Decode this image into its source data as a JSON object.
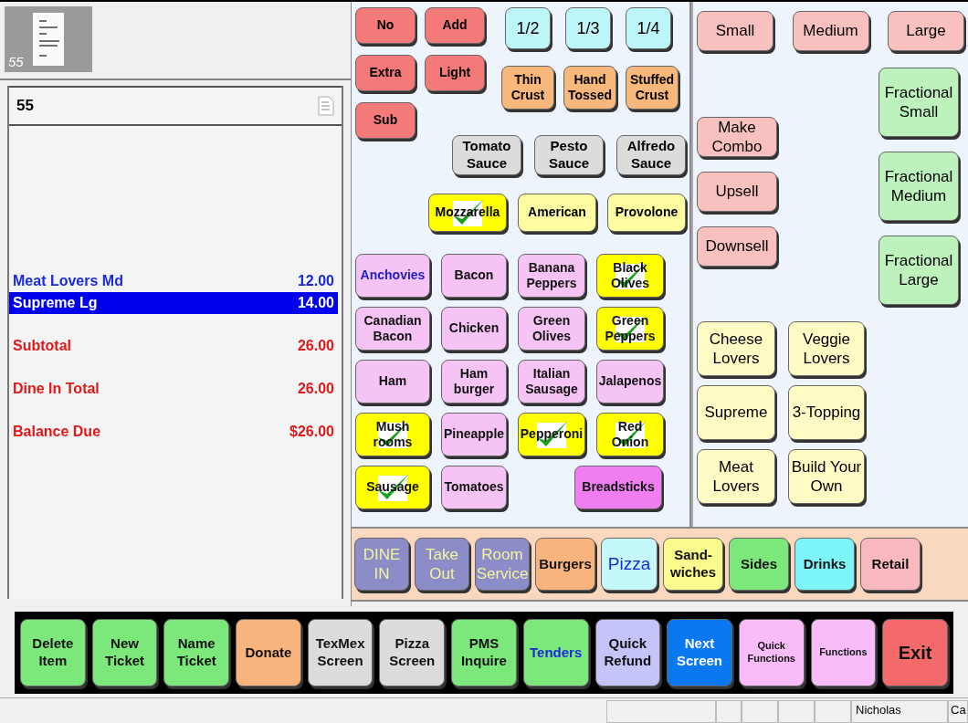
{
  "ticket_tab": {
    "number": "55"
  },
  "receipt": {
    "header": "55",
    "lines": [
      {
        "kind": "item",
        "name": "Meat Lovers Md",
        "amount": "12.00",
        "selected": false
      },
      {
        "kind": "item",
        "name": "Supreme Lg",
        "amount": "14.00",
        "selected": true
      },
      {
        "kind": "total",
        "name": "Subtotal",
        "amount": "26.00",
        "selected": false
      },
      {
        "kind": "total",
        "name": "Dine In Total",
        "amount": "26.00",
        "selected": false
      },
      {
        "kind": "total",
        "name": "Balance Due",
        "amount": "$26.00",
        "selected": false
      }
    ]
  },
  "modifiers": [
    "No",
    "Add",
    "Extra",
    "Light",
    "Sub"
  ],
  "portions": [
    "1/2",
    "1/3",
    "1/4"
  ],
  "crusts": [
    "Thin Crust",
    "Hand Tossed",
    "Stuffed Crust"
  ],
  "sauces": [
    "Tomato Sauce",
    "Pesto Sauce",
    "Alfredo Sauce"
  ],
  "cheeses": [
    {
      "label": "Mozzarella",
      "checked": true
    },
    {
      "label": "American",
      "checked": false
    },
    {
      "label": "Provolone",
      "checked": false
    }
  ],
  "toppings": [
    {
      "kind": "topping",
      "label": "Anchovies",
      "checked": false,
      "highlighted": true
    },
    {
      "kind": "topping",
      "label": "Bacon",
      "checked": false,
      "highlighted": false
    },
    {
      "kind": "topping",
      "label": "Banana Peppers",
      "checked": false,
      "highlighted": false
    },
    {
      "kind": "topping",
      "label": "Black Olives",
      "checked": true,
      "highlighted": false
    },
    {
      "kind": "topping",
      "label": "Canadian Bacon",
      "checked": false,
      "highlighted": false
    },
    {
      "kind": "topping",
      "label": "Chicken",
      "checked": false,
      "highlighted": false
    },
    {
      "kind": "topping",
      "label": "Green Olives",
      "checked": false,
      "highlighted": false
    },
    {
      "kind": "topping",
      "label": "Green Peppers",
      "checked": true,
      "highlighted": false
    },
    {
      "kind": "topping",
      "label": "Ham",
      "checked": false,
      "highlighted": false
    },
    {
      "kind": "topping",
      "label": "Ham burger",
      "checked": false,
      "highlighted": false
    },
    {
      "kind": "topping",
      "label": "Italian Sausage",
      "checked": false,
      "highlighted": false
    },
    {
      "kind": "topping",
      "label": "Jalapenos",
      "checked": false,
      "highlighted": false
    },
    {
      "kind": "topping",
      "label": "Mush rooms",
      "checked": true,
      "highlighted": false
    },
    {
      "kind": "topping",
      "label": "Pineapple",
      "checked": false,
      "highlighted": false
    },
    {
      "kind": "topping",
      "label": "Pepperoni",
      "checked": true,
      "highlighted": false
    },
    {
      "kind": "topping",
      "label": "Red Onion",
      "checked": true,
      "highlighted": false
    },
    {
      "kind": "topping",
      "label": "Sausage",
      "checked": true,
      "highlighted": false
    },
    {
      "kind": "topping",
      "label": "Tomatoes",
      "checked": false,
      "highlighted": false
    },
    {
      "kind": "side",
      "label": "Breadsticks",
      "checked": false,
      "highlighted": false
    }
  ],
  "sizes": [
    "Small",
    "Medium",
    "Large"
  ],
  "sell_options": [
    "Make Combo",
    "Upsell",
    "Downsell"
  ],
  "fractional_sizes": [
    "Fractional Small",
    "Fractional Medium",
    "Fractional Large"
  ],
  "specialty_pizzas": [
    "Cheese Lovers",
    "Veggie Lovers",
    "Supreme",
    "3-Topping",
    "Meat Lovers",
    "Build Your Own"
  ],
  "categories": [
    {
      "label": "DINE IN",
      "color": "#8c8cc8",
      "selected": false
    },
    {
      "label": "Take Out",
      "color": "#8c8cc8",
      "selected": false
    },
    {
      "label": "Room Service",
      "color": "#8c8cc8",
      "selected": false
    },
    {
      "label": "Burgers",
      "color": "#f8b47c",
      "selected": false
    },
    {
      "label": "Pizza",
      "color": "#c4f8fa",
      "selected": true
    },
    {
      "label": "Sand-wiches",
      "color": "#fbfa8c",
      "selected": false
    },
    {
      "label": "Sides",
      "color": "#7ce87c",
      "selected": false
    },
    {
      "label": "Drinks",
      "color": "#7cf4f8",
      "selected": false
    },
    {
      "label": "Retail",
      "color": "#f9b8c0",
      "selected": false
    }
  ],
  "functions": [
    {
      "kind": "action",
      "label": "Delete Item",
      "color": "#7ce87c"
    },
    {
      "kind": "action",
      "label": "New Ticket",
      "color": "#7ce87c"
    },
    {
      "kind": "action",
      "label": "Name Ticket",
      "color": "#7ce87c"
    },
    {
      "kind": "action",
      "label": "Donate",
      "color": "#f8b47c"
    },
    {
      "kind": "action",
      "label": "TexMex Screen",
      "color": "#dcdcdc"
    },
    {
      "kind": "action",
      "label": "Pizza Screen",
      "color": "#dcdcdc"
    },
    {
      "kind": "action",
      "label": "PMS Inquire",
      "color": "#7ce87c"
    },
    {
      "kind": "payment",
      "label": "Tenders",
      "color": "#7ce87c"
    },
    {
      "kind": "action",
      "label": "Quick Refund",
      "color": "#c4c4f8"
    },
    {
      "kind": "navigation",
      "label": "Next Screen",
      "color": "#0a78f0"
    },
    {
      "kind": "menu",
      "label": "Quick Functions",
      "color": "#f8bcf8"
    },
    {
      "kind": "menu",
      "label": "Functions",
      "color": "#f8bcf8"
    },
    {
      "kind": "exit",
      "label": "Exit",
      "color": "#f46a6a"
    }
  ],
  "status_bar": {
    "user": "Nicholas",
    "field_2": "Ca"
  }
}
